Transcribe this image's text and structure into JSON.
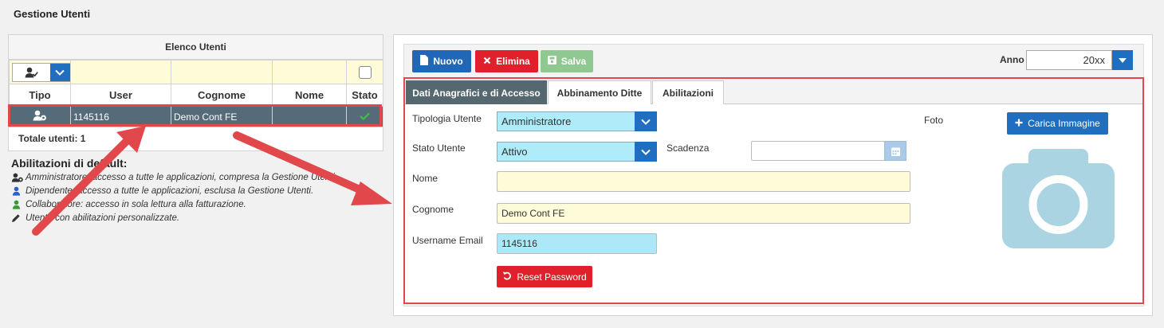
{
  "page_title": "Gestione Utenti",
  "users_list": {
    "title": "Elenco Utenti",
    "columns": [
      "Tipo",
      "User",
      "Cognome",
      "Nome",
      "Stato"
    ],
    "row": {
      "user": "1145116",
      "cognome": "Demo Cont FE",
      "nome": ""
    },
    "totals": "Totale utenti: 1"
  },
  "legend": {
    "title": "Abilitazioni di default:",
    "items": [
      "Amministratore: accesso a tutte le applicazioni, compresa la Gestione Utenti.",
      "Dipendente: accesso a tutte le applicazioni, esclusa la Gestione Utenti.",
      "Collaboratore: accesso in sola lettura alla fatturazione.",
      "Utente con abilitazioni personalizzate."
    ]
  },
  "toolbar": {
    "nuovo": "Nuovo",
    "elimina": "Elimina",
    "salva": "Salva",
    "anno_label": "Anno",
    "anno_value": "20xx"
  },
  "tabs": [
    "Dati Anagrafici e di Accesso",
    "Abbinamento Ditte",
    "Abilitazioni"
  ],
  "form": {
    "tipologia_label": "Tipologia Utente",
    "tipologia_value": "Amministratore",
    "stato_label": "Stato Utente",
    "stato_value": "Attivo",
    "scadenza_label": "Scadenza",
    "scadenza_value": "",
    "nome_label": "Nome",
    "nome_value": "",
    "cognome_label": "Cognome",
    "cognome_value": "Demo Cont FE",
    "email_label": "Username Email",
    "email_value": "1145116",
    "reset_label": "Reset Password",
    "foto_label": "Foto",
    "carica_label": "Carica Immagine"
  },
  "colors": {
    "primary": "#1f6ec0",
    "danger": "#e0202b",
    "success_disabled": "#8fc890",
    "highlight": "#e0484c",
    "active_tab": "#55676f"
  }
}
